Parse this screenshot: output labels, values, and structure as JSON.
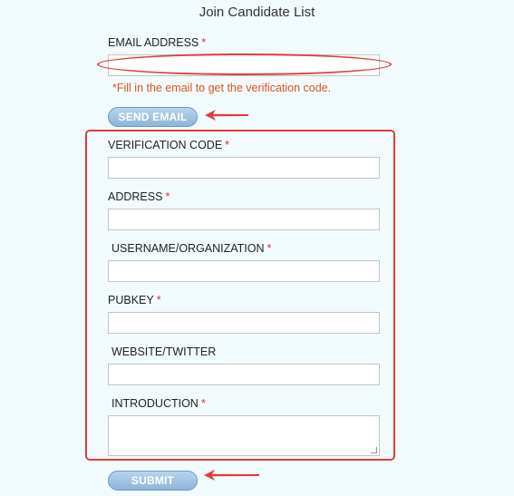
{
  "form": {
    "title": "Join Candidate List",
    "email_label": "EMAIL ADDRESS",
    "email_value": "",
    "required_mark": "*",
    "email_hint": "*Fill in the email to get the verification code.",
    "send_email_label": "SEND EMAIL",
    "verification_code_label": "VERIFICATION CODE",
    "address_label": "ADDRESS",
    "username_label": "USERNAME/ORGANIZATION",
    "pubkey_label": "PUBKEY",
    "website_label": "WEBSITE/TWITTER",
    "introduction_label": "INTRODUCTION",
    "submit_label": "SUBMIT"
  },
  "colors": {
    "background": "#f1fbfd",
    "annotation_red": "#e23b3b",
    "hint_orange": "#e0521c",
    "button_blue": "#8db4da"
  }
}
